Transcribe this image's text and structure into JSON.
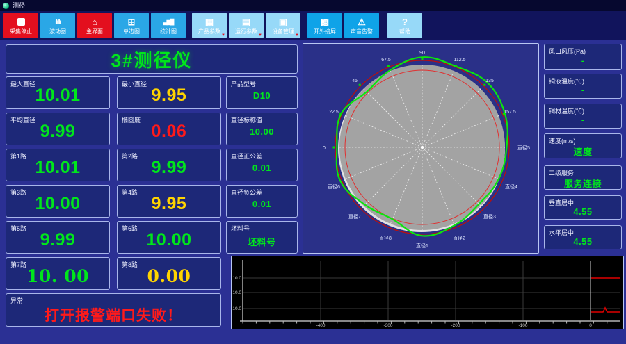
{
  "window": {
    "title": "测径"
  },
  "toolbar": {
    "buttons": [
      {
        "label": "采集停止"
      },
      {
        "label": "波动图"
      },
      {
        "label": "主界面"
      },
      {
        "label": "单边图"
      },
      {
        "label": "统计图"
      },
      {
        "label": "产品参数"
      },
      {
        "label": "运行参数"
      },
      {
        "label": "设备管理"
      },
      {
        "label": "开外接屏"
      },
      {
        "label": "声音告警"
      },
      {
        "label": "帮助"
      }
    ]
  },
  "panel": {
    "title": "3#测径仪"
  },
  "cells": {
    "max": {
      "label": "最大直径",
      "value": "10.01"
    },
    "min": {
      "label": "最小直径",
      "value": "9.95"
    },
    "model": {
      "label": "产品型号",
      "value": "D10"
    },
    "avg": {
      "label": "平均直径",
      "value": "9.99"
    },
    "oval": {
      "label": "椭圆度",
      "value": "0.06"
    },
    "nominal": {
      "label": "直径标称值",
      "value": "10.00"
    },
    "ch1": {
      "label": "第1路",
      "value": "10.01"
    },
    "ch2": {
      "label": "第2路",
      "value": "9.99"
    },
    "tolplus": {
      "label": "直径正公差",
      "value": "0.01"
    },
    "ch3": {
      "label": "第3路",
      "value": "10.00"
    },
    "ch4": {
      "label": "第4路",
      "value": "9.95"
    },
    "tolminus": {
      "label": "直径负公差",
      "value": "0.01"
    },
    "ch5": {
      "label": "第5路",
      "value": "9.99"
    },
    "ch6": {
      "label": "第6路",
      "value": "10.00"
    },
    "billet": {
      "label": "坯料号",
      "value": "坯料号"
    },
    "ch7": {
      "label": "第7路",
      "value": "10. 00"
    },
    "ch8": {
      "label": "第8路",
      "value": "0.00"
    },
    "alarm": {
      "label": "异常",
      "value": "打开报警端口失败！"
    }
  },
  "right": {
    "items": [
      {
        "label": "风口风压(Pa)",
        "value": "-"
      },
      {
        "label": "铜液温度(℃)",
        "value": "-"
      },
      {
        "label": "铜材温度(℃)",
        "value": "-"
      },
      {
        "label": "速度(m/s)",
        "value": "速度"
      },
      {
        "label": "二级服务",
        "value": "服务连接"
      },
      {
        "label": "垂直居中",
        "value": "4.55"
      },
      {
        "label": "水平居中",
        "value": "4.55"
      }
    ]
  },
  "colors": {
    "value_green": "#00e61c",
    "value_yellow": "#ffd400",
    "value_red": "#ff1a1a",
    "button_red": "#e30f1e",
    "button_cyan": "#2aa7e6",
    "button_light_blue": "#97d9f8",
    "profile_green": "#0ce60c",
    "tolerance_red": "#cc1212"
  },
  "chart_data": [
    {
      "type": "polar-profile",
      "title": "产品断面轮廓 (cross-section profile)",
      "angle_labels": [
        "0",
        "22.5",
        "45",
        "67.5",
        "90",
        "112.5",
        "135",
        "157.5"
      ],
      "diameter_labels": [
        "直径5",
        "直径4",
        "直径3",
        "直径2",
        "直径1",
        "直径8",
        "直径7",
        "直径6"
      ],
      "series": [
        {
          "name": "measured_profile_green",
          "radii_relative": [
            1.02,
            1.08,
            1.11,
            1.06,
            1.09,
            1.01,
            0.95,
            1.06,
            1.03,
            1.07,
            0.98,
            0.94,
            1.07,
            1.02,
            0.97,
            1.0
          ]
        },
        {
          "name": "tolerance_outer_red_circle",
          "radius_relative": 1.05
        },
        {
          "name": "tolerance_inner_red_circle",
          "radius_relative": 0.93
        },
        {
          "name": "nominal_gray_disk",
          "radius_relative": 1.0
        }
      ],
      "legend_position": "none",
      "grid": "16 dashed radial spokes every 22.5 deg"
    },
    {
      "type": "line",
      "title": "直径趋势 (diameter vs length)",
      "x_ticks": [
        "-400",
        "-300",
        "-200",
        "-100",
        "0"
      ],
      "y_ticks": [
        "10.0",
        "10.0",
        "10.0"
      ],
      "series": [
        {
          "name": "upper_tolerance_red",
          "x_range": [
            0,
            50
          ],
          "y_gridline_index": 0
        },
        {
          "name": "lower_tolerance_red",
          "x_range": [
            0,
            50
          ],
          "y_gridline_index": 2,
          "marker": "small spike near x=20"
        }
      ],
      "plot_bg": "#000000",
      "grid": true,
      "legend_position": "none"
    }
  ]
}
